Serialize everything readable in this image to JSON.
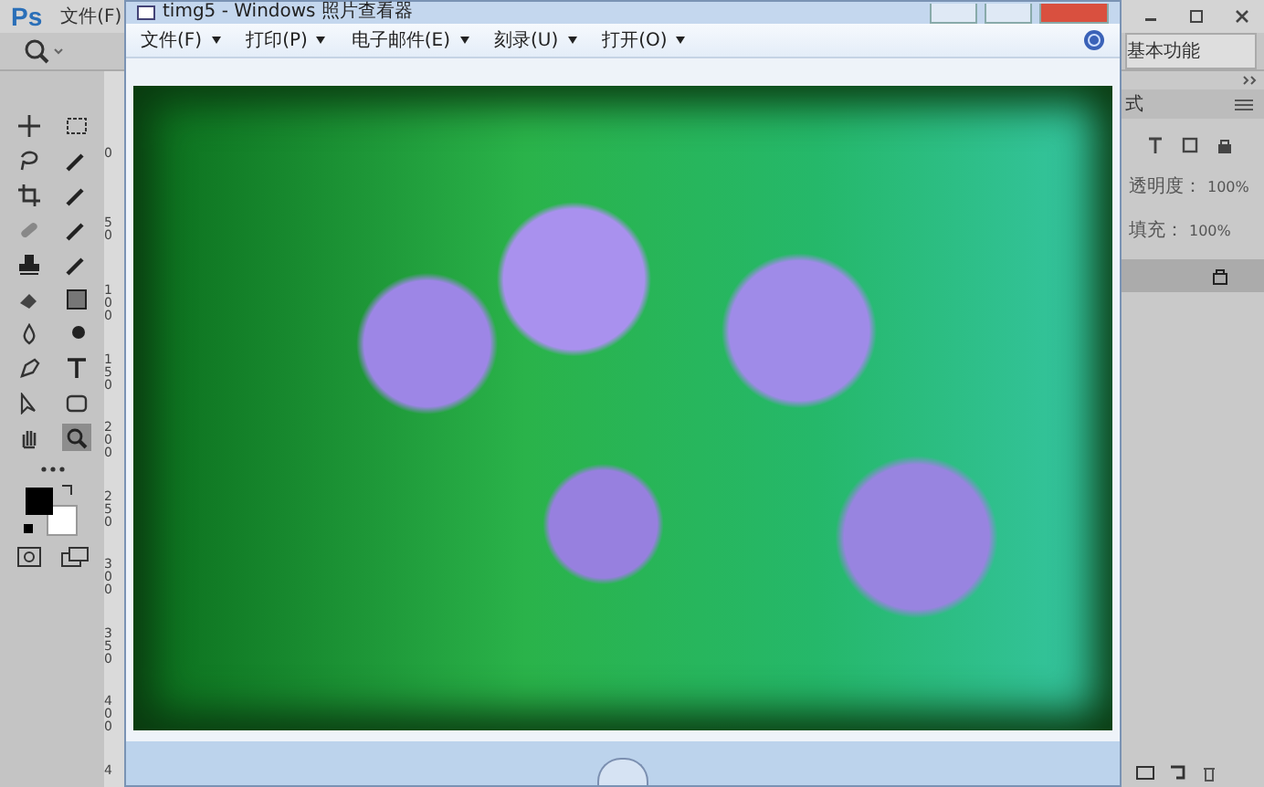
{
  "photoshop": {
    "logo": "Ps",
    "menu": [
      "文件(F)"
    ],
    "tools": [
      {
        "kind": "move",
        "selected": false
      },
      {
        "kind": "marquee",
        "selected": false
      },
      {
        "kind": "lasso",
        "selected": false
      },
      {
        "kind": "wand",
        "selected": false
      },
      {
        "kind": "crop",
        "selected": false
      },
      {
        "kind": "eyedropper",
        "selected": false
      },
      {
        "kind": "bandage",
        "selected": false
      },
      {
        "kind": "brush",
        "selected": false
      },
      {
        "kind": "stamp",
        "selected": false
      },
      {
        "kind": "history",
        "selected": false
      },
      {
        "kind": "eraser",
        "selected": false
      },
      {
        "kind": "gradient",
        "selected": false
      },
      {
        "kind": "blur",
        "selected": false
      },
      {
        "kind": "dodge",
        "selected": false
      },
      {
        "kind": "pen",
        "selected": false
      },
      {
        "kind": "type",
        "selected": false
      },
      {
        "kind": "select",
        "selected": false
      },
      {
        "kind": "shape",
        "selected": false
      },
      {
        "kind": "hand",
        "selected": false
      },
      {
        "kind": "zoom",
        "selected": true
      }
    ],
    "ruler": [
      "0",
      "50",
      "100",
      "150",
      "200",
      "250",
      "300",
      "350",
      "400",
      "4"
    ],
    "workspace": "基本功能",
    "panel_tab": "式",
    "opacity_label": "透明度：",
    "opacity_value": "100%",
    "fill_label": "填充：",
    "fill_value": "100%"
  },
  "viewer": {
    "title": "timg5 - Windows 照片查看器",
    "menu": [
      {
        "label": "文件(F)"
      },
      {
        "label": "打印(P)"
      },
      {
        "label": "电子邮件(E)"
      },
      {
        "label": "刻录(U)"
      },
      {
        "label": "打开(O)"
      }
    ]
  }
}
